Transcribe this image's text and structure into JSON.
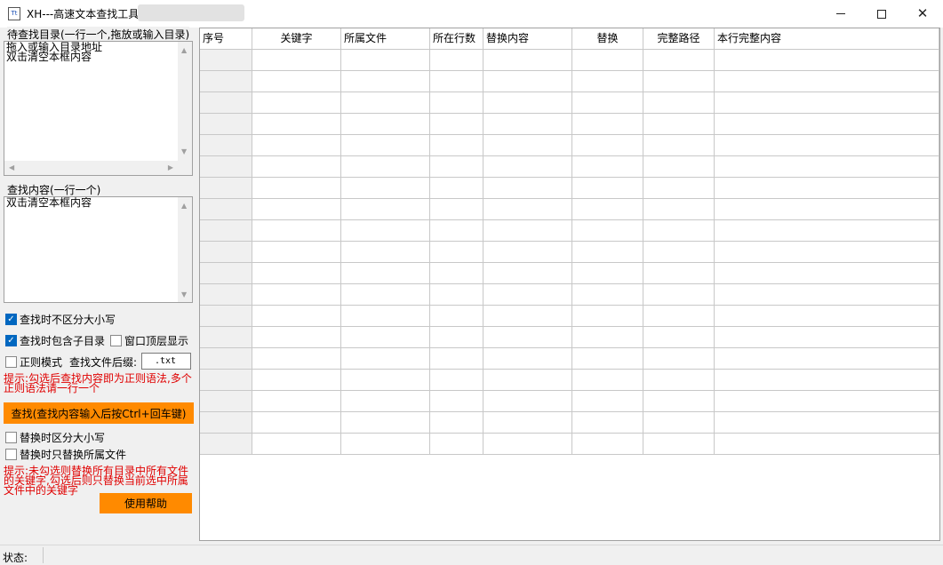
{
  "window": {
    "title": "XH---高速文本查找工具",
    "icon": "text-file-icon"
  },
  "dir_group": {
    "label": "待查找目录(一行一个,拖放或输入目录)",
    "text": "拖入或输入目录地址\n双击清空本框内容"
  },
  "content_group": {
    "label": "查找内容(一行一个)",
    "text": "双击清空本框内容"
  },
  "options": {
    "case_insensitive": {
      "label": "查找时不区分大小写",
      "checked": true
    },
    "include_subdirs": {
      "label": "查找时包含子目录",
      "checked": true
    },
    "topmost": {
      "label": "窗口顶层显示",
      "checked": false
    },
    "regex": {
      "label": "正则模式",
      "checked": false
    },
    "suffix_label": "查找文件后缀:",
    "suffix_value": ".txt"
  },
  "hint1": "提示:勾选后查找内容即为正则语法,多个正则语法请一行一个",
  "search_button": "查找(查找内容输入后按Ctrl+回车键)",
  "replace_options": {
    "case_sensitive": {
      "label": "替换时区分大小写",
      "checked": false
    },
    "only_selected": {
      "label": "替换时只替换所属文件",
      "checked": false
    }
  },
  "hint2": "提示:未勾选则替换所有目录中所有文件的关键字,勾选后则只替换当前选中所属文件中的关键字",
  "help_button": "使用帮助",
  "grid": {
    "columns": [
      "序号",
      "关键字",
      "所属文件",
      "所在行数",
      "替换内容",
      "替换",
      "完整路径",
      "本行完整内容"
    ],
    "row_count": 19
  },
  "status": {
    "label": "状态:"
  }
}
